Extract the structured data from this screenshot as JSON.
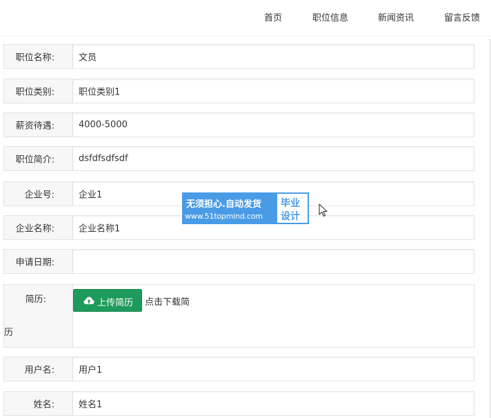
{
  "nav": {
    "items": [
      "首页",
      "职位信息",
      "新闻资讯",
      "留言反馈"
    ]
  },
  "form": {
    "job_name": {
      "label": "职位名称:",
      "value": "文员"
    },
    "job_category": {
      "label": "职位类别:",
      "value": "职位类别1"
    },
    "salary": {
      "label": "薪资待遇:",
      "value": "4000-5000"
    },
    "job_intro": {
      "label": "职位简介:",
      "value": "dsfdfsdfsdf"
    },
    "company_no": {
      "label": "企业号:",
      "value": "企业1"
    },
    "company_name": {
      "label": "企业名称:",
      "value": "企业名称1"
    },
    "apply_date": {
      "label": "申请日期:",
      "value": ""
    },
    "resume": {
      "label": "简历:",
      "upload_label": "上传简历",
      "download_text_1": "点击下载简",
      "download_text_2": "历"
    },
    "username": {
      "label": "用户名:",
      "value": "用户1"
    },
    "name": {
      "label": "姓名:",
      "value": "姓名1"
    }
  },
  "watermark": {
    "line1": "无须担心.自动发货",
    "line2": "www.51topmind.com",
    "right_line1": "毕业",
    "right_line2": "设计"
  },
  "colors": {
    "upload_button": "#1e9b5c",
    "watermark_blue": "#4a9be6"
  },
  "icons": {
    "upload": "cloud-upload-icon",
    "cursor": "mouse-pointer-icon"
  }
}
